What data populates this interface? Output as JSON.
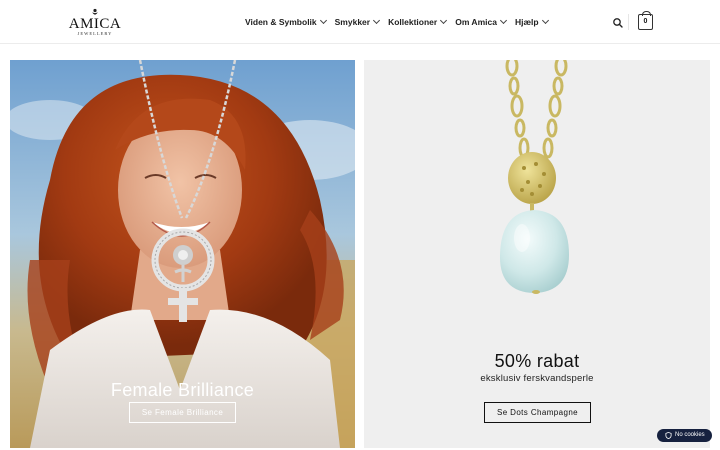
{
  "brand": {
    "name": "AMICA",
    "tagline": "JEWELLERY"
  },
  "nav": {
    "items": [
      {
        "label": "Viden & Symbolik"
      },
      {
        "label": "Smykker"
      },
      {
        "label": "Kollektioner"
      },
      {
        "label": "Om Amica"
      },
      {
        "label": "Hjælp"
      }
    ]
  },
  "cart": {
    "count": "0"
  },
  "promo_left": {
    "headline": "Female Brilliance",
    "button_label": "Se Female Brilliance"
  },
  "promo_right": {
    "headline": "50% rabat",
    "subheadline": "eksklusiv ferskvandsperle",
    "button_label": "Se Dots Champagne"
  },
  "cookie_widget": {
    "label": "No cookies"
  },
  "colors": {
    "cookie_bg": "#16213f",
    "right_card_bg": "#efefef",
    "text_dark": "#111111"
  },
  "icons": [
    "search-icon",
    "cart-bag-icon",
    "chevron-down-icon",
    "shield-icon"
  ]
}
